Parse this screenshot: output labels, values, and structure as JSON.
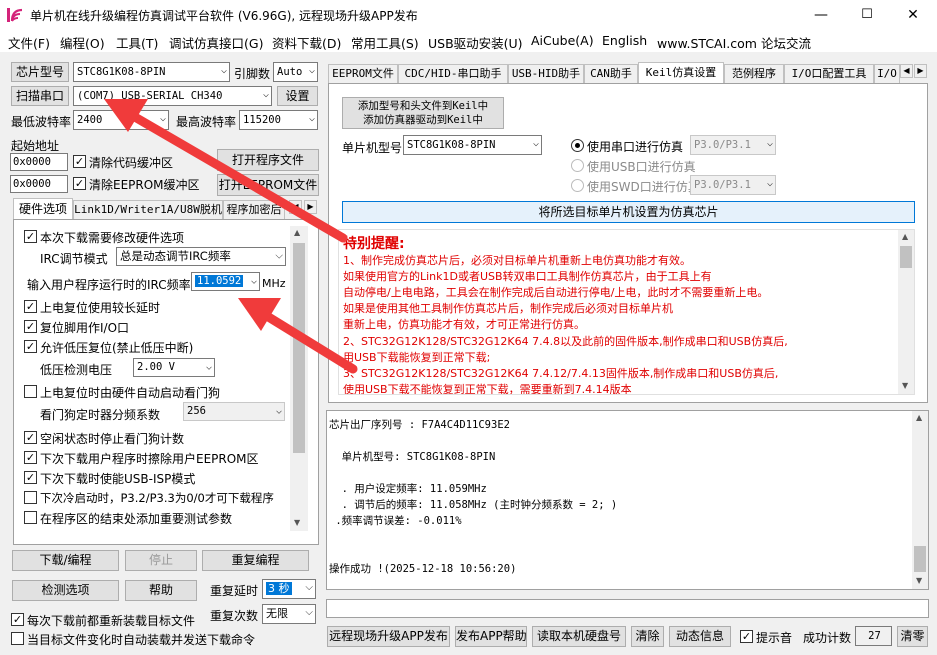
{
  "window": {
    "title": "单片机在线升级编程仿真调试平台软件 (V6.96G), 远程现场升级APP发布",
    "controls": {
      "minimize": "—",
      "maximize": "☐",
      "close": "✕"
    }
  },
  "menu": [
    "文件(F)",
    "编程(O)",
    "工具(T)",
    "调试仿真接口(G)",
    "资料下载(D)",
    "常用工具(S)",
    "USB驱动安装(U)",
    "AiCube(A)",
    "English",
    "www.STCAI.com 论坛交流"
  ],
  "left": {
    "chip_type_btn": "芯片型号",
    "chip_type_value": "STC8G1K08-8PIN",
    "pin_count_label": "引脚数",
    "pin_count_value": "Auto",
    "scan_port_btn": "扫描串口",
    "port_value": "(COM7) USB-SERIAL CH340",
    "settings_btn": "设置",
    "min_baud_label": "最低波特率",
    "min_baud_value": "2400",
    "max_baud_label": "最高波特率",
    "max_baud_value": "115200",
    "start_addr_label": "起始地址",
    "code_addr": "0x0000",
    "clear_code_label": "清除代码缓冲区",
    "open_prog_btn": "打开程序文件",
    "eeprom_addr": "0x0000",
    "clear_eeprom_label": "清除EEPROM缓冲区",
    "open_eeprom_btn": "打开EEPROM文件",
    "tabs": [
      "硬件选项",
      "Link1D/Writer1A/U8W脱机",
      "程序加密后"
    ],
    "hw_options": {
      "modify_hw": "本次下载需要修改硬件选项",
      "irc_mode_label": "IRC调节模式",
      "irc_mode_value": "总是动态调节IRC频率",
      "irc_freq_label": "输入用户程序运行时的IRC频率",
      "irc_freq_value": "11.0592",
      "irc_unit": "MHz",
      "power_reset_delay": "上电复位使用较长延时",
      "reset_pin_io": "复位脚用作I/O口",
      "low_voltage_reset": "允许低压复位(禁止低压中断)",
      "lv_detect_label": "低压检测电压",
      "lv_detect_value": "2.00 V",
      "auto_wdt": "上电复位时由硬件自动启动看门狗",
      "wdt_div_label": "看门狗定时器分频系数",
      "wdt_div_value": "256",
      "idle_stop_wdt": "空闲状态时停止看门狗计数",
      "erase_eeprom": "下次下载用户程序时擦除用户EEPROM区",
      "usb_isp": "下次下载时使能USB-ISP模式",
      "cold_boot": "下次冷启动时，P3.2/P3.3为0/0才可下载程序",
      "add_test_params": "在程序区的结束处添加重要测试参数"
    },
    "download_btn": "下载/编程",
    "stop_btn": "停止",
    "reprogram_btn": "重复编程",
    "check_btn": "检测选项",
    "help_btn": "帮助",
    "repeat_delay_label": "重复延时",
    "repeat_delay_value": "3 秒",
    "repeat_count_label": "重复次数",
    "repeat_count_value": "无限",
    "reload_every": "每次下载前都重新装载目标文件",
    "auto_reload": "当目标文件变化时自动装载并发送下载命令"
  },
  "right": {
    "tabs": [
      "EEPROM文件",
      "CDC/HID-串口助手",
      "USB-HID助手",
      "CAN助手",
      "Keil仿真设置",
      "范例程序",
      "I/O口配置工具",
      "I/O"
    ],
    "add_keil_btn_line1": "添加型号和头文件到Keil中",
    "add_keil_btn_line2": "添加仿真器驱动到Keil中",
    "mcu_model_label": "单片机型号",
    "mcu_model_value": "STC8G1K08-8PIN",
    "sim_serial": "使用串口进行仿真",
    "sim_serial_port": "P3.0/P3.1",
    "sim_usb": "使用USB口进行仿真",
    "sim_swd": "使用SWD口进行仿真",
    "sim_swd_port": "P3.0/P3.1",
    "set_sim_chip_btn": "将所选目标单片机设置为仿真芯片",
    "notice_title": "特别提醒:",
    "notice_lines": [
      "1、制作完成仿真芯片后，必须对目标单片机重新上电仿真功能才有效。",
      "   如果使用官方的Link1D或者USB转双串口工具制作仿真芯片，由于工具上有",
      "   自动停电/上电电路，工具会在制作完成后自动进行停电/上电，此时才不需要重新上电。",
      "   如果是使用其他工具制作仿真芯片后，制作完成后必须对目标单片机",
      "   重新上电，仿真功能才有效，才可正常进行仿真。",
      "2、STC32G12K128/STC32G12K64  7.4.8以及此前的固件版本,制作成串口和USB仿真后,",
      "   用USB下载能恢复到正常下载;",
      "3、STC32G12K128/STC32G12K64  7.4.12/7.4.13固件版本,制作成串口和USB仿真后,",
      "   使用USB下载不能恢复到正常下载，需要重新到7.4.14版本"
    ],
    "log_lines": [
      "芯片出厂序列号 : F7A4C4D11C93E2",
      "",
      "  单片机型号: STC8G1K08-8PIN",
      "",
      "  . 用户设定频率: 11.059MHz",
      "  . 调节后的频率: 11.058MHz (主时钟分频系数 = 2; )",
      " .频率调节误差: -0.011%",
      "",
      "",
      "",
      "操作成功 !(2025-12-18 10:56:20)"
    ],
    "remote_upgrade_btn": "远程现场升级APP发布",
    "publish_help_btn": "发布APP帮助",
    "read_disk_btn": "读取本机硬盘号",
    "clear_btn": "清除",
    "anim_btn": "动态信息",
    "beep_label": "提示音",
    "success_count_label": "成功计数",
    "success_count_value": "27",
    "reset_count_btn": "清零"
  },
  "colors": {
    "accent_red": "#e00000",
    "arrow_red": "#f03b3b",
    "selection_blue": "#0078d7"
  }
}
